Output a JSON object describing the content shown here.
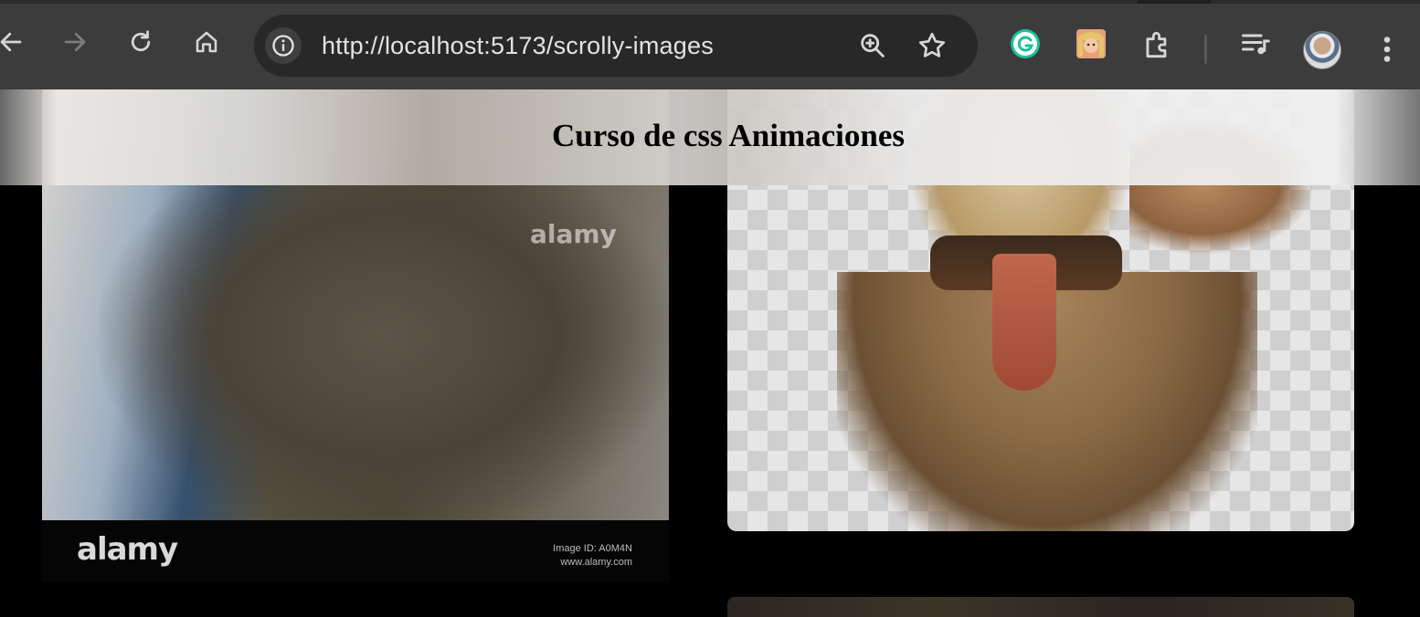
{
  "browser": {
    "url": "http://localhost:5173/scrolly-images",
    "toolbar_icons": [
      "back-icon",
      "forward-icon",
      "reload-icon",
      "home-icon",
      "site-info-icon",
      "zoom-icon",
      "bookmark-star-icon",
      "grammarly-extension-icon",
      "profile-extension-icon",
      "extensions-puzzle-icon",
      "media-control-icon",
      "profile-avatar",
      "menu-kebab-icon"
    ]
  },
  "page": {
    "header_title": "Curso de css Animaciones",
    "left_image": {
      "watermark": "alamy",
      "logo": "alamy",
      "stock_line1": "Image ID: A0M4N",
      "stock_line2": "www.alamy.com"
    }
  },
  "colors": {
    "chrome_bg": "#3c3c3c",
    "omnibox_bg": "#282828",
    "url_text": "#e3e3e3",
    "page_bg": "#000000"
  }
}
